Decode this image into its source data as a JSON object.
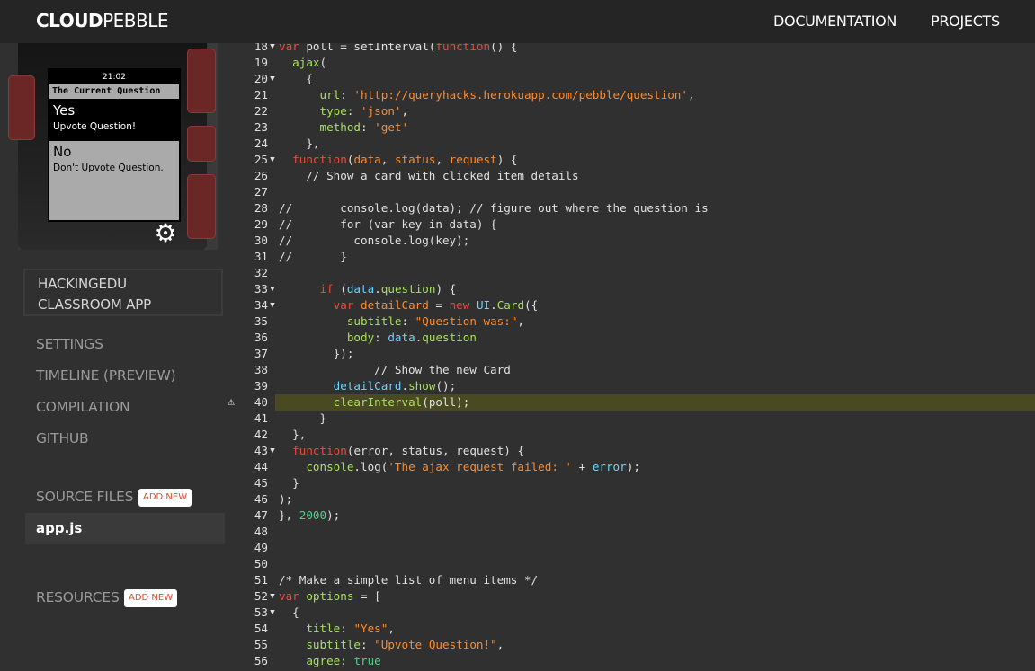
{
  "header": {
    "logo_bold": "CLOUD",
    "logo_light": "PEBBLE",
    "nav": [
      "DOCUMENTATION",
      "PROJECTS"
    ]
  },
  "emulator": {
    "time": "21:02",
    "card_title": "The Current Question",
    "menu": [
      {
        "title": "Yes",
        "subtitle": "Upvote Question!"
      },
      {
        "title": "No",
        "subtitle": "Don't Upvote Question."
      }
    ],
    "settings_icon": "gear-icon"
  },
  "sidebar": {
    "project_name_line1": "HACKINGEDU",
    "project_name_line2": "CLASSROOM APP",
    "links": [
      "SETTINGS",
      "TIMELINE (PREVIEW)",
      "COMPILATION",
      "GITHUB"
    ],
    "source_files_label": "SOURCE FILES",
    "add_new_label": "ADD NEW",
    "files": [
      "app.js"
    ],
    "resources_label": "RESOURCES"
  },
  "colors": {
    "keyword": "#f4463d",
    "string": "#ff8a2a",
    "number": "#4fd18a",
    "property": "#a8e05a",
    "variable": "#68d6ff",
    "highlight_line": "#4a4a22",
    "add_new_text": "#e0493a",
    "watch_button": "#6b2626"
  },
  "editor": {
    "highlighted_line": 40,
    "warning_line": 40,
    "lines": [
      {
        "n": "18",
        "fold": true,
        "tokens": [
          [
            "kw",
            "var "
          ],
          [
            "p",
            "poll = "
          ],
          [
            "p",
            "setInterval("
          ],
          [
            "kw",
            "function"
          ],
          [
            "p",
            "() {"
          ]
        ]
      },
      {
        "n": "19",
        "fold": false,
        "tokens": [
          [
            "p",
            "  "
          ],
          [
            "prop",
            "ajax"
          ],
          [
            "p",
            "("
          ]
        ]
      },
      {
        "n": "20",
        "fold": true,
        "tokens": [
          [
            "p",
            "    {"
          ]
        ]
      },
      {
        "n": "21",
        "fold": false,
        "tokens": [
          [
            "p",
            "      "
          ],
          [
            "prop",
            "url"
          ],
          [
            "p",
            ": "
          ],
          [
            "str",
            "'http://queryhacks.herokuapp.com/pebble/question'"
          ],
          [
            "p",
            ","
          ]
        ]
      },
      {
        "n": "22",
        "fold": false,
        "tokens": [
          [
            "p",
            "      "
          ],
          [
            "prop",
            "type"
          ],
          [
            "p",
            ": "
          ],
          [
            "str",
            "'json'"
          ],
          [
            "p",
            ","
          ]
        ]
      },
      {
        "n": "23",
        "fold": false,
        "tokens": [
          [
            "p",
            "      "
          ],
          [
            "prop",
            "method"
          ],
          [
            "p",
            ": "
          ],
          [
            "str",
            "'get'"
          ]
        ]
      },
      {
        "n": "24",
        "fold": false,
        "tokens": [
          [
            "p",
            "    },"
          ]
        ]
      },
      {
        "n": "25",
        "fold": true,
        "tokens": [
          [
            "p",
            "  "
          ],
          [
            "kw",
            "function"
          ],
          [
            "p",
            "("
          ],
          [
            "str",
            "data"
          ],
          [
            "p",
            ", "
          ],
          [
            "str",
            "status"
          ],
          [
            "p",
            ", "
          ],
          [
            "str",
            "request"
          ],
          [
            "p",
            ") {"
          ]
        ]
      },
      {
        "n": "26",
        "fold": false,
        "tokens": [
          [
            "com",
            "    // Show a card with clicked item details"
          ]
        ]
      },
      {
        "n": "27",
        "fold": false,
        "tokens": [
          [
            "p",
            ""
          ]
        ]
      },
      {
        "n": "28",
        "fold": false,
        "tokens": [
          [
            "com",
            "//       console.log(data); // figure out where the question is"
          ]
        ]
      },
      {
        "n": "29",
        "fold": false,
        "tokens": [
          [
            "com",
            "//       for (var key in data) {"
          ]
        ]
      },
      {
        "n": "30",
        "fold": false,
        "tokens": [
          [
            "com",
            "//         console.log(key);"
          ]
        ]
      },
      {
        "n": "31",
        "fold": false,
        "tokens": [
          [
            "com",
            "//       }"
          ]
        ]
      },
      {
        "n": "32",
        "fold": false,
        "tokens": [
          [
            "p",
            ""
          ]
        ]
      },
      {
        "n": "33",
        "fold": true,
        "tokens": [
          [
            "p",
            "      "
          ],
          [
            "kw",
            "if"
          ],
          [
            "p",
            " ("
          ],
          [
            "var",
            "data"
          ],
          [
            "p",
            "."
          ],
          [
            "prop",
            "question"
          ],
          [
            "p",
            ") {"
          ]
        ]
      },
      {
        "n": "34",
        "fold": true,
        "tokens": [
          [
            "p",
            "        "
          ],
          [
            "kw",
            "var "
          ],
          [
            "str",
            "detailCard"
          ],
          [
            "p",
            " = "
          ],
          [
            "kw",
            "new "
          ],
          [
            "var",
            "UI"
          ],
          [
            "p",
            "."
          ],
          [
            "prop",
            "Card"
          ],
          [
            "p",
            "({"
          ]
        ]
      },
      {
        "n": "35",
        "fold": false,
        "tokens": [
          [
            "p",
            "          "
          ],
          [
            "prop",
            "subtitle"
          ],
          [
            "p",
            ": "
          ],
          [
            "str",
            "\"Question was:\""
          ],
          [
            "p",
            ","
          ]
        ]
      },
      {
        "n": "36",
        "fold": false,
        "tokens": [
          [
            "p",
            "          "
          ],
          [
            "prop",
            "body"
          ],
          [
            "p",
            ": "
          ],
          [
            "var",
            "data"
          ],
          [
            "p",
            "."
          ],
          [
            "prop",
            "question"
          ]
        ]
      },
      {
        "n": "37",
        "fold": false,
        "tokens": [
          [
            "p",
            "        });"
          ]
        ]
      },
      {
        "n": "38",
        "fold": false,
        "tokens": [
          [
            "com",
            "              // Show the new Card"
          ]
        ]
      },
      {
        "n": "39",
        "fold": false,
        "tokens": [
          [
            "p",
            "        "
          ],
          [
            "var",
            "detailCard"
          ],
          [
            "p",
            "."
          ],
          [
            "prop",
            "show"
          ],
          [
            "p",
            "();"
          ]
        ]
      },
      {
        "n": "40",
        "fold": false,
        "tokens": [
          [
            "p",
            "        "
          ],
          [
            "prop",
            "clearInterval"
          ],
          [
            "p",
            "(poll);"
          ]
        ]
      },
      {
        "n": "41",
        "fold": false,
        "tokens": [
          [
            "p",
            "      }"
          ]
        ]
      },
      {
        "n": "42",
        "fold": false,
        "tokens": [
          [
            "p",
            "  },"
          ]
        ]
      },
      {
        "n": "43",
        "fold": true,
        "tokens": [
          [
            "p",
            "  "
          ],
          [
            "kw",
            "function"
          ],
          [
            "p",
            "("
          ],
          [
            "p",
            "error"
          ],
          [
            "p",
            ", "
          ],
          [
            "p",
            "status"
          ],
          [
            "p",
            ", "
          ],
          [
            "p",
            "request"
          ],
          [
            "p",
            ") {"
          ]
        ]
      },
      {
        "n": "44",
        "fold": false,
        "tokens": [
          [
            "p",
            "    "
          ],
          [
            "prop",
            "console"
          ],
          [
            "p",
            ".log("
          ],
          [
            "str",
            "'The ajax request failed: '"
          ],
          [
            "p",
            " + "
          ],
          [
            "var",
            "error"
          ],
          [
            "p",
            ");"
          ]
        ]
      },
      {
        "n": "45",
        "fold": false,
        "tokens": [
          [
            "p",
            "  }"
          ]
        ]
      },
      {
        "n": "46",
        "fold": false,
        "tokens": [
          [
            "p",
            ");"
          ]
        ]
      },
      {
        "n": "47",
        "fold": false,
        "tokens": [
          [
            "p",
            "}, "
          ],
          [
            "num",
            "2000"
          ],
          [
            "p",
            ");"
          ]
        ]
      },
      {
        "n": "48",
        "fold": false,
        "tokens": [
          [
            "p",
            ""
          ]
        ]
      },
      {
        "n": "49",
        "fold": false,
        "tokens": [
          [
            "p",
            ""
          ]
        ]
      },
      {
        "n": "50",
        "fold": false,
        "tokens": [
          [
            "p",
            ""
          ]
        ]
      },
      {
        "n": "51",
        "fold": false,
        "tokens": [
          [
            "com",
            "/* Make a simple list of menu items */"
          ]
        ]
      },
      {
        "n": "52",
        "fold": true,
        "tokens": [
          [
            "kw",
            "var "
          ],
          [
            "prop",
            "options"
          ],
          [
            "p",
            " = ["
          ]
        ]
      },
      {
        "n": "53",
        "fold": true,
        "tokens": [
          [
            "p",
            "  {"
          ]
        ]
      },
      {
        "n": "54",
        "fold": false,
        "tokens": [
          [
            "p",
            "    "
          ],
          [
            "prop",
            "title"
          ],
          [
            "p",
            ": "
          ],
          [
            "str",
            "\"Yes\""
          ],
          [
            "p",
            ","
          ]
        ]
      },
      {
        "n": "55",
        "fold": false,
        "tokens": [
          [
            "p",
            "    "
          ],
          [
            "prop",
            "subtitle"
          ],
          [
            "p",
            ": "
          ],
          [
            "str",
            "\"Upvote Question!\""
          ],
          [
            "p",
            ","
          ]
        ]
      },
      {
        "n": "56",
        "fold": false,
        "tokens": [
          [
            "p",
            "    "
          ],
          [
            "prop",
            "agree"
          ],
          [
            "p",
            ": "
          ],
          [
            "num",
            "true"
          ]
        ]
      }
    ]
  }
}
